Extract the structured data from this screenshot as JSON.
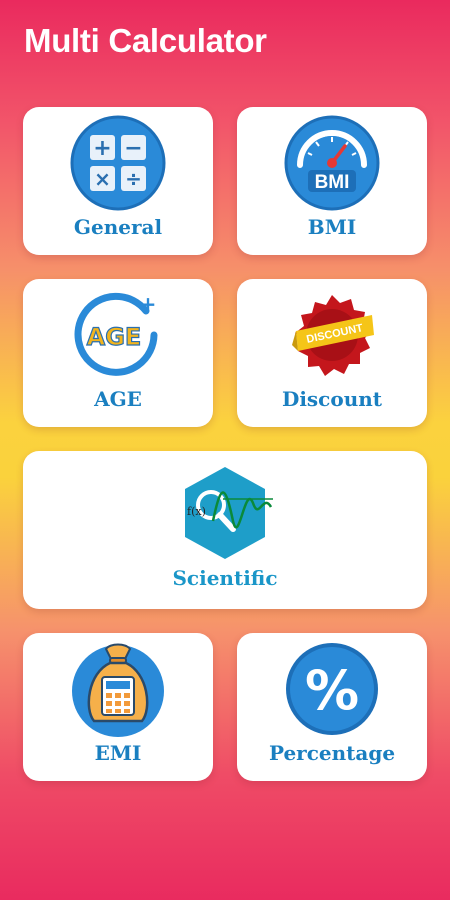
{
  "app": {
    "title": "Multi Calculator"
  },
  "cards": {
    "general": {
      "label": "General",
      "icon": "calculator-operators-icon"
    },
    "bmi": {
      "label": "BMI",
      "icon": "bmi-gauge-icon",
      "icon_text": "BMI"
    },
    "age": {
      "label": "AGE",
      "icon": "age-plus-icon",
      "icon_text": "AGE"
    },
    "discount": {
      "label": "Discount",
      "icon": "discount-badge-icon",
      "icon_text": "DISCOUNT"
    },
    "scientific": {
      "label": "Scientific",
      "icon": "scientific-function-icon",
      "icon_text": "f(x)"
    },
    "emi": {
      "label": "EMI",
      "icon": "money-bag-calculator-icon"
    },
    "percentage": {
      "label": "Percentage",
      "icon": "percent-icon",
      "icon_text": "%"
    }
  },
  "colors": {
    "label_blue": "#1a7fc0",
    "icon_blue": "#2a8ad8",
    "gradient_pink": "#ea2a5e",
    "gradient_yellow": "#fbd23e"
  }
}
